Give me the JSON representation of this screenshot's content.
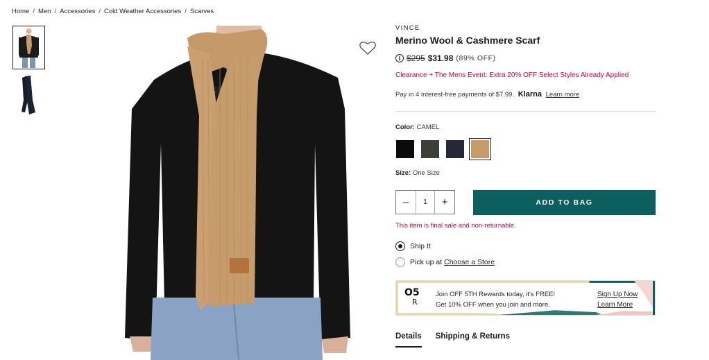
{
  "breadcrumb": [
    "Home",
    "Men",
    "Accessories",
    "Cold Weather Accessories",
    "Scarves"
  ],
  "product": {
    "brand": "VINCE",
    "title": "Merino Wool & Cashmere Scarf",
    "original_price": "$295",
    "sale_price": "$31.98",
    "discount": "(89% OFF)",
    "promo": "Clearance + The Mens Event: Extra 20% OFF Select Styles Already Applied"
  },
  "klarna": {
    "text": "Pay in 4 interest-free payments of $7.99.",
    "logo": "Klarna",
    "link": "Learn more"
  },
  "color": {
    "label": "Color:",
    "selected": "CAMEL",
    "swatches": [
      {
        "name": "black",
        "hex": "#0b0b0b"
      },
      {
        "name": "olive",
        "hex": "#3c3f38"
      },
      {
        "name": "navy",
        "hex": "#242936"
      },
      {
        "name": "camel",
        "hex": "#c89b6b"
      }
    ]
  },
  "size": {
    "label": "Size:",
    "value": "One Size"
  },
  "quantity": {
    "value": "1",
    "minus": "–",
    "plus": "+"
  },
  "add_to_bag": "ADD TO BAG",
  "final_sale": "This item is final sale and non-returnable.",
  "shipping": {
    "ship_label": "Ship It",
    "pickup_label": "Pick up at",
    "pickup_link": "Choose a Store"
  },
  "rewards": {
    "logo_top": "O5",
    "logo_bottom": "R",
    "line1": "Join OFF 5TH Rewards today, it's FREE!",
    "line2": "Get 10% OFF when you join and more.",
    "signup": "Sign Up Now",
    "learn": "Learn More"
  },
  "tabs": [
    "Details",
    "Shipping & Returns"
  ],
  "icons": {
    "wishlist": "heart-icon",
    "info": "info-icon"
  }
}
